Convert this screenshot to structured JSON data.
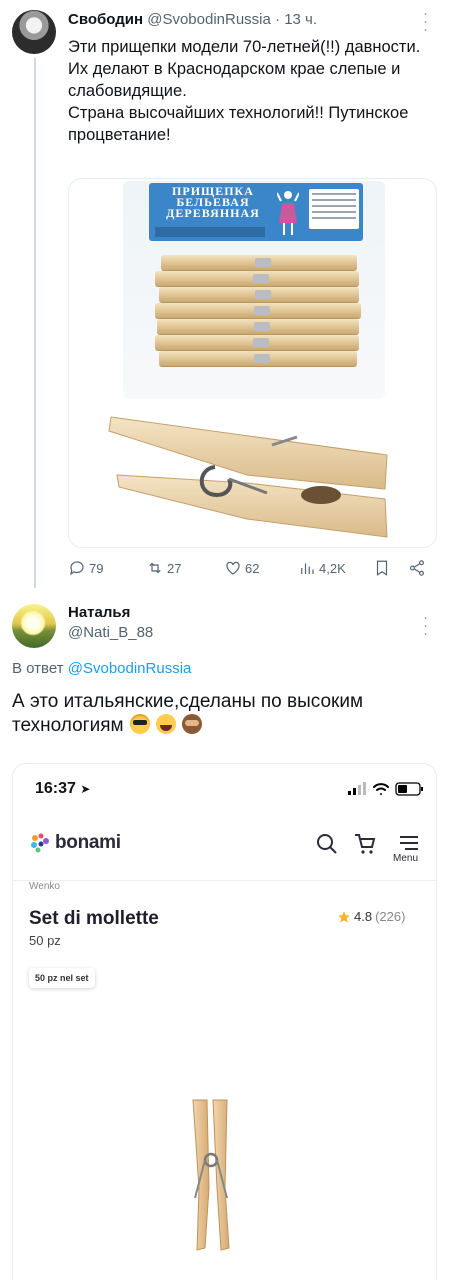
{
  "tweet": {
    "author_name": "Свободин",
    "author_handle": "@SvobodinRussia · 13 ч.",
    "more": "⋮",
    "text_lines": [
      "Эти прищепки модели 70-летней(!!) давности.",
      "Их делают в Краснодарском крае слепые и слабовидящие.",
      "Страна высочайших технологий!! Путинское процветание!"
    ],
    "package_label": "ПРИЩЕПКА БЕЛЬЕВАЯ ДЕРЕВЯННАЯ",
    "stats": {
      "replies": "79",
      "reposts": "27",
      "likes": "62",
      "views": "4,2K"
    }
  },
  "reply": {
    "author_name": "Наталья",
    "author_handle": "@Nati_B_88",
    "more": "⋮",
    "reply_prefix": "В ответ",
    "reply_to": "@SvobodinRussia",
    "text": "А это итальянские,сделаны по высоким технологиям"
  },
  "embedded_screenshot": {
    "status_time": "16:37",
    "brand": "bonami",
    "menu_label": "Menu",
    "vendor": "Wenko",
    "product_title": "Set di mollette",
    "product_subtitle": "50 pz",
    "rating_value": "4.8",
    "rating_count": "(226)",
    "chip_label": "50 pz nel set"
  },
  "colors": {
    "link": "#1d9bf0",
    "secondary_text": "#536471",
    "star": "#f5b52a"
  }
}
